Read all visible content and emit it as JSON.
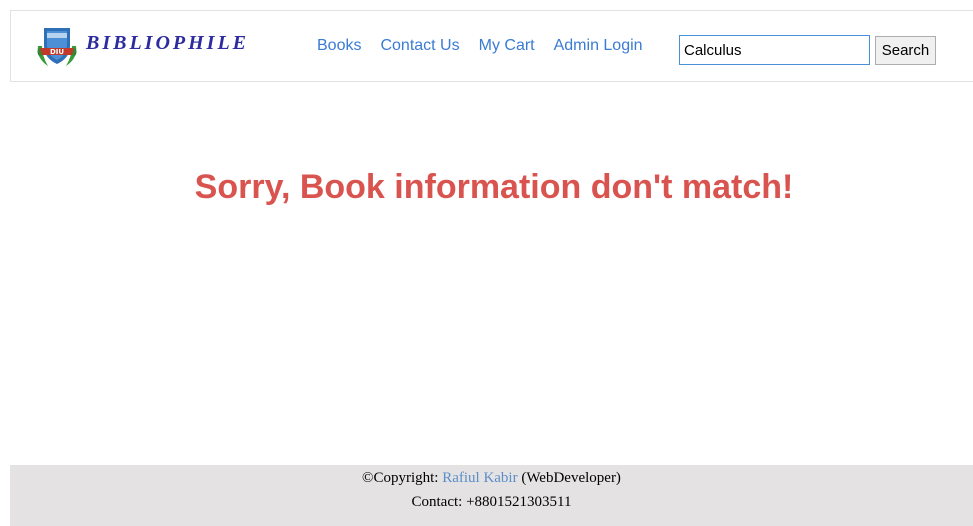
{
  "brand": {
    "name": "BIBLIOPHILE",
    "logo_text": "DIU",
    "logo_colors": {
      "shield": "#2e6fb8",
      "laurel": "#3a9a3a",
      "ribbon": "#c0392b"
    }
  },
  "nav": {
    "items": [
      {
        "label": "Books"
      },
      {
        "label": "Contact Us"
      },
      {
        "label": "My Cart"
      },
      {
        "label": "Admin Login"
      }
    ]
  },
  "search": {
    "value": "Calculus",
    "button_label": "Search"
  },
  "main": {
    "message": "Sorry, Book information don't match!",
    "message_color": "#d9534f"
  },
  "footer": {
    "copyright_prefix": "©Copyright:",
    "author": "Rafiul Kabir",
    "author_suffix": "(WebDeveloper)",
    "contact": "Contact: +8801521303511"
  },
  "colors": {
    "link": "#3a7bd5",
    "brand": "#2c2ca0",
    "footer_bg": "#e4e2e2"
  }
}
